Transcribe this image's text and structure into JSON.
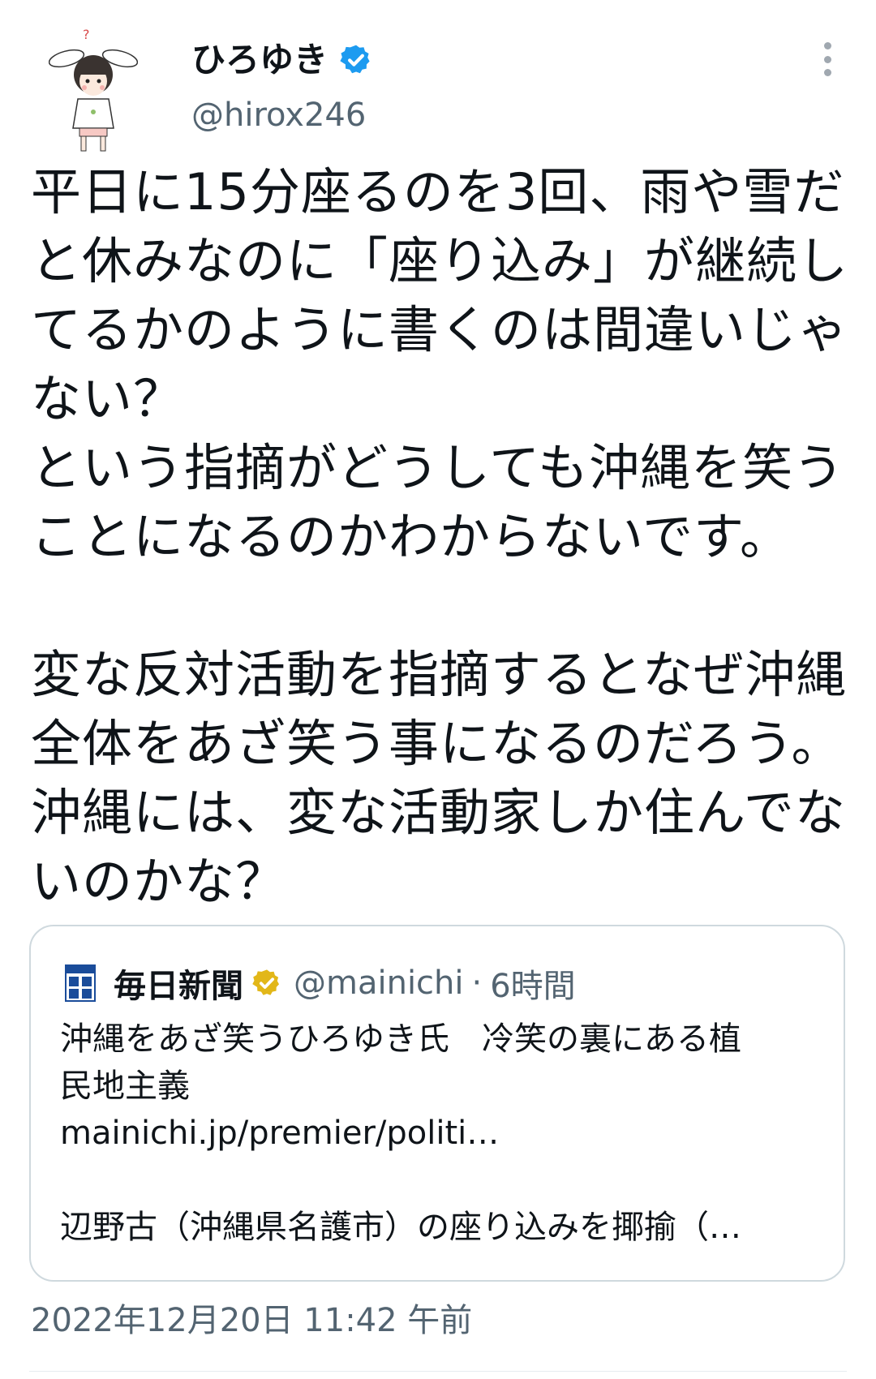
{
  "author": {
    "display_name": "ひろゆき",
    "handle": "@hirox246",
    "verified_color": "#1d9bf0"
  },
  "tweet": {
    "paragraph_1": [
      "平日に15分座るのを3回、雨や雪だ",
      "と休みなのに「座り込み」が継続し",
      "てるかのように書くのは間違いじゃ",
      "ない？",
      "という指摘がどうしても沖縄を笑う",
      "ことになるのかわからないです。"
    ],
    "paragraph_2": [
      "変な反対活動を指摘するとなぜ沖縄",
      "全体をあざ笑う事になるのだろう。",
      "沖縄には、変な活動家しか住んでな",
      "いのかな？"
    ]
  },
  "quote": {
    "logo_icon": "mainichi-logo-icon",
    "name": "毎日新聞",
    "verified_color": "#e2b719",
    "handle": "@mainichi",
    "separator": "·",
    "time": "6時間",
    "headline_lines": [
      "沖縄をあざ笑うひろゆき氏　冷笑の裏にある植",
      "民地主義"
    ],
    "link": "mainichi.jp/premier/politi…",
    "excerpt": "辺野古（沖縄県名護市）の座り込みを揶揄（…"
  },
  "timestamp": "2022年12月20日 11:42 午前",
  "colors": {
    "text": "#0f1419",
    "secondary": "#536471",
    "border": "#cfd9de"
  },
  "icons": {
    "avatar": "bunny-ear-avatar-icon",
    "more": "more-vertical-icon",
    "verified": "verified-badge-icon"
  }
}
